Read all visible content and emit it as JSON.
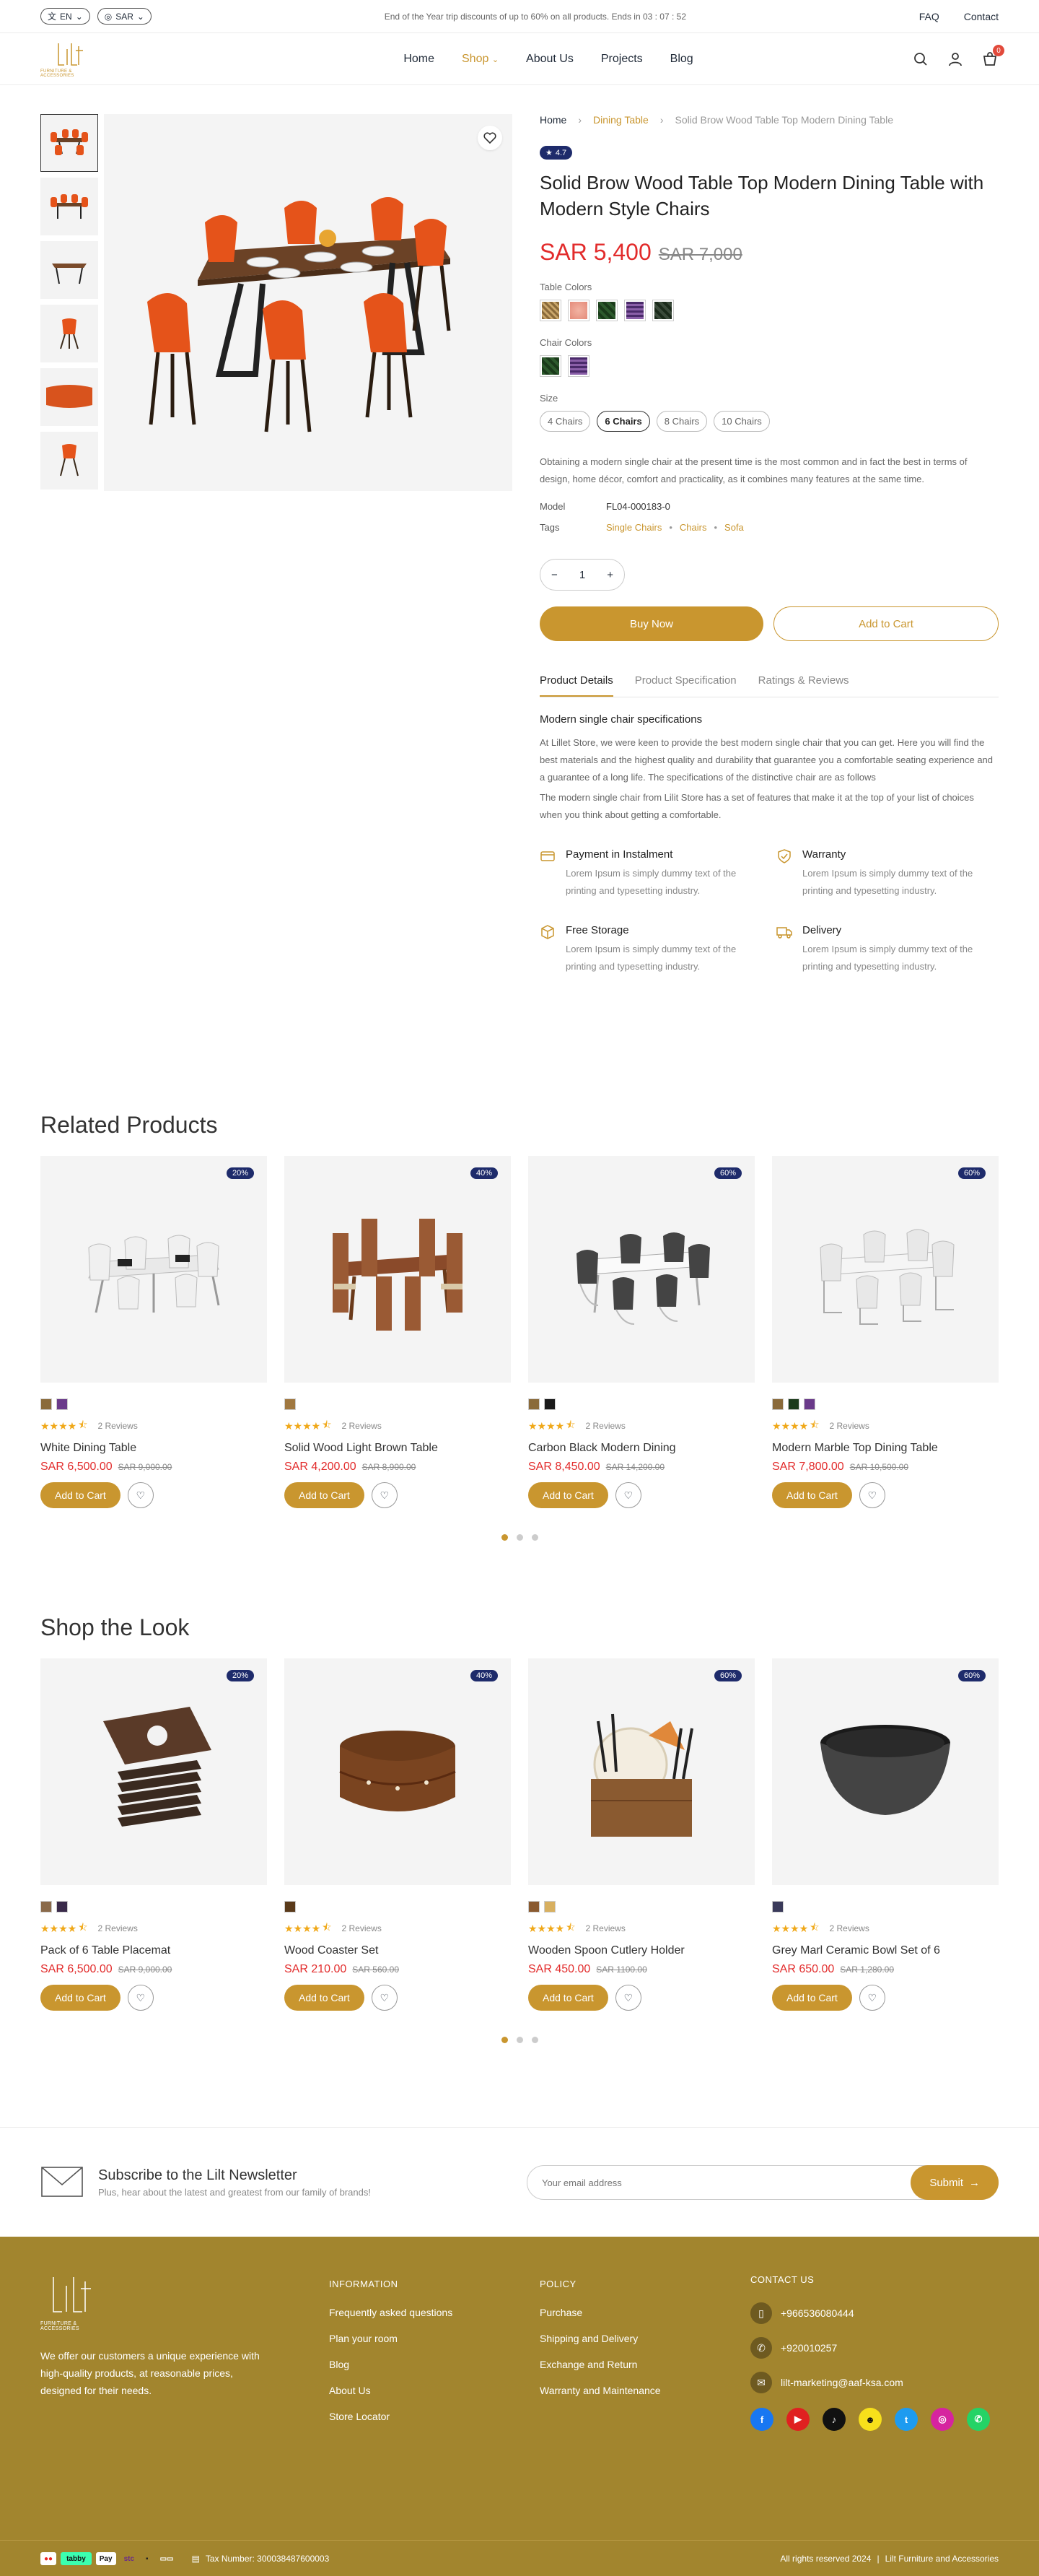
{
  "topbar": {
    "lang": "EN",
    "currency": "SAR",
    "promo": "End of the Year trip discounts of up to 60% on all products. Ends in 03 : 07 : 52",
    "faq": "FAQ",
    "contact": "Contact"
  },
  "brand": {
    "tagline": "FURNITURE & ACCESSORIES",
    "accent": "#c9962f",
    "navy": "#1e2b6b"
  },
  "nav": {
    "home": "Home",
    "shop": "Shop",
    "about": "About Us",
    "projects": "Projects",
    "blog": "Blog",
    "cart_count": "0"
  },
  "product": {
    "breadcrumb": [
      "Home",
      "Dining Table",
      "Solid Brow Wood Table Top Modern Dining Table"
    ],
    "rating": "4.7",
    "title": "Solid Brow Wood Table Top Modern Dining Table with Modern Style Chairs",
    "price": "SAR 5,400",
    "old_price": "SAR 7,000",
    "table_colors_label": "Table Colors",
    "chair_colors_label": "Chair Colors",
    "size_label": "Size",
    "sizes": [
      "4 Chairs",
      "6 Chairs",
      "8 Chairs",
      "10 Chairs"
    ],
    "description": "Obtaining a modern single chair at the present time is the most common and in fact the best in terms of design, home décor, comfort and practicality, as it combines many features at the same time.",
    "model_label": "Model",
    "model": "FL04-000183-0",
    "tags_label": "Tags",
    "tags": [
      "Single Chairs",
      "Chairs",
      "Sofa"
    ],
    "qty": "1",
    "buy_now": "Buy Now",
    "add_to_cart": "Add to Cart",
    "tabs": [
      "Product Details",
      "Product Specification",
      "Ratings & Reviews"
    ],
    "spec_heading": "Modern single chair specifications",
    "spec_p1": "At Lillet Store, we were keen to provide the best modern single chair that you can get. Here you will find the best materials and the highest quality and durability that guarantee you a comfortable seating experience and a guarantee of a long life. The specifications of the distinctive chair are as follows",
    "spec_p2": "The modern single chair from Lilit Store has a set of features that make it at the top of your list of choices when you think about getting a comfortable.",
    "features": [
      {
        "title": "Payment in Instalment",
        "text": "Lorem Ipsum is simply dummy text of the printing and typesetting industry."
      },
      {
        "title": "Warranty",
        "text": "Lorem Ipsum is simply dummy text of the printing and typesetting industry."
      },
      {
        "title": "Free Storage",
        "text": "Lorem Ipsum is simply dummy text of the printing and typesetting industry."
      },
      {
        "title": "Delivery",
        "text": "Lorem Ipsum is simply dummy text of the printing and typesetting industry."
      }
    ]
  },
  "related": {
    "title": "Related Products",
    "items": [
      {
        "badge": "20%",
        "reviews": "2 Reviews",
        "name": "White Dining Table",
        "price": "SAR 6,500.00",
        "old": "SAR 9,000.00",
        "cta": "Add to Cart"
      },
      {
        "badge": "40%",
        "reviews": "2 Reviews",
        "name": "Solid Wood Light Brown Table",
        "price": "SAR 4,200.00",
        "old": "SAR 8,900.00",
        "cta": "Add to Cart"
      },
      {
        "badge": "60%",
        "reviews": "2 Reviews",
        "name": "Carbon Black Modern Dining",
        "price": "SAR 8,450.00",
        "old": "SAR 14,200.00",
        "cta": "Add to Cart"
      },
      {
        "badge": "60%",
        "reviews": "2 Reviews",
        "name": "Modern Marble Top Dining Table",
        "price": "SAR 7,800.00",
        "old": "SAR 10,500.00",
        "cta": "Add to Cart"
      }
    ]
  },
  "look": {
    "title": "Shop the Look",
    "items": [
      {
        "badge": "20%",
        "reviews": "2 Reviews",
        "name": "Pack of 6 Table Placemat",
        "price": "SAR 6,500.00",
        "old": "SAR 9,000.00",
        "cta": "Add to Cart"
      },
      {
        "badge": "40%",
        "reviews": "2 Reviews",
        "name": "Wood Coaster Set",
        "price": "SAR 210.00",
        "old": "SAR 560.00",
        "cta": "Add to Cart"
      },
      {
        "badge": "60%",
        "reviews": "2 Reviews",
        "name": "Wooden Spoon Cutlery Holder",
        "price": "SAR 450.00",
        "old": "SAR 1100.00",
        "cta": "Add to Cart"
      },
      {
        "badge": "60%",
        "reviews": "2 Reviews",
        "name": "Grey Marl Ceramic Bowl Set of 6",
        "price": "SAR 650.00",
        "old": "SAR 1,280.00",
        "cta": "Add to Cart"
      }
    ]
  },
  "newsletter": {
    "title": "Subscribe to the Lilt Newsletter",
    "subtitle": "Plus, hear about the latest and greatest from our family of brands!",
    "placeholder": "Your email address",
    "submit": "Submit"
  },
  "footer": {
    "about": "We offer our customers a unique experience with high-quality products, at reasonable prices, designed for their needs.",
    "info_title": "INFORMATION",
    "info": [
      "Frequently asked questions",
      "Plan your room",
      "Blog",
      "About Us",
      "Store Locator"
    ],
    "policy_title": "POLICY",
    "policy": [
      "Purchase",
      "Shipping and Delivery",
      "Exchange and Return",
      "Warranty and Maintenance"
    ],
    "contact_title": "CONTACT US",
    "phone1": "+966536080444",
    "phone2": "+920010257",
    "email": "lilt-marketing@aaf-ksa.com",
    "tax": "Tax Number: 300038487600003",
    "rights": "All rights reserved 2024",
    "company": "Lilt Furniture and Accessories"
  }
}
